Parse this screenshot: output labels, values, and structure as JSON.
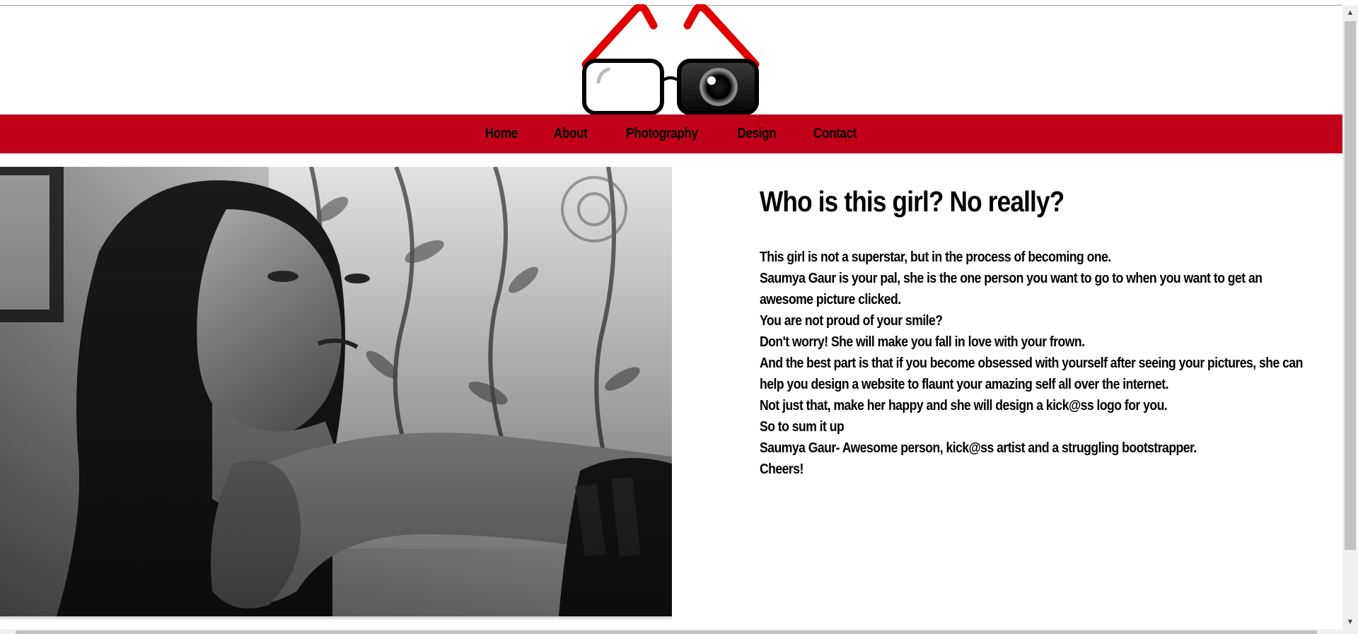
{
  "nav": {
    "items": [
      {
        "label": "Home"
      },
      {
        "label": "About"
      },
      {
        "label": "Photography"
      },
      {
        "label": "Design"
      },
      {
        "label": "Contact"
      }
    ]
  },
  "about": {
    "heading": "Who is this girl? No really?",
    "lines": [
      "This girl is not a superstar, but in the process of becoming one.",
      "Saumya Gaur is your pal, she is the one person you want to go to when you want to get an awesome picture clicked.",
      "You are not proud of your smile?",
      "Don't worry! She will make you fall in love with your frown.",
      "And the best part is that if you become obsessed with yourself after seeing your pictures, she can help you design a website to flaunt your amazing self all over the internet.",
      "Not just that, make her happy and she will design a kick@ss logo for you.",
      "So to sum it up",
      "Saumya Gaur- Awesome person, kick@ss artist and a struggling bootstrapper.",
      "Cheers!"
    ]
  },
  "icons": {
    "logo": "glasses-logo-icon",
    "scroll_up": "chevron-up-icon",
    "scroll_down": "chevron-down-icon"
  },
  "colors": {
    "nav_background": "#c1001a",
    "logo_red": "#e00000",
    "text": "#000000"
  }
}
